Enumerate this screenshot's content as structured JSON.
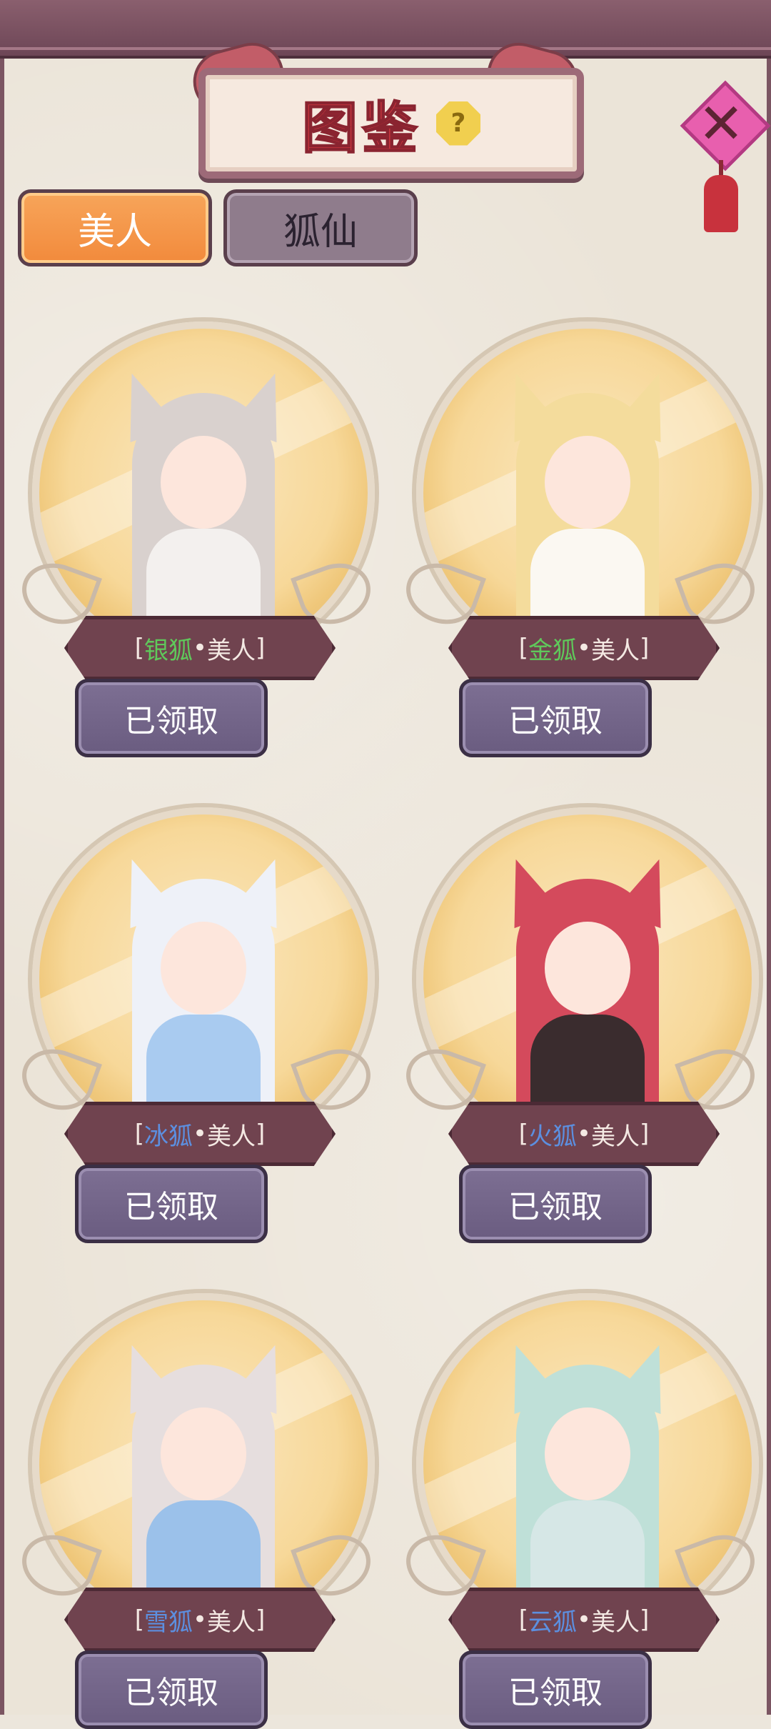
{
  "header": {
    "title": "图鉴",
    "help_icon": "question-mark-icon"
  },
  "close": {
    "icon": "chinese-knot-close-icon"
  },
  "tabs": [
    {
      "label": "美人",
      "active": true
    },
    {
      "label": "狐仙",
      "active": false
    }
  ],
  "cards": [
    {
      "species": "银狐",
      "species_color": "#5fc95b",
      "suffix": "美人",
      "button": "已领取",
      "hair": "#d9d1ce",
      "outfit": "#f3f0ee"
    },
    {
      "species": "金狐",
      "species_color": "#5fc95b",
      "suffix": "美人",
      "button": "已领取",
      "hair": "#f4dc9c",
      "outfit": "#fbf8f2"
    },
    {
      "species": "冰狐",
      "species_color": "#5c8fe0",
      "suffix": "美人",
      "button": "已领取",
      "hair": "#eef1f8",
      "outfit": "#a9cbf0"
    },
    {
      "species": "火狐",
      "species_color": "#5c8fe0",
      "suffix": "美人",
      "button": "已领取",
      "hair": "#d44a5c",
      "outfit": "#3a2c2e"
    },
    {
      "species": "雪狐",
      "species_color": "#5c8fe0",
      "suffix": "美人",
      "button": "已领取",
      "hair": "#e6dede",
      "outfit": "#9bc1ea"
    },
    {
      "species": "云狐",
      "species_color": "#5c8fe0",
      "suffix": "美人",
      "button": "已领取",
      "hair": "#bfe0d8",
      "outfit": "#d6e7e6"
    }
  ],
  "labels": {
    "bracket_open": "[",
    "bracket_close": "]",
    "dot": "•"
  }
}
